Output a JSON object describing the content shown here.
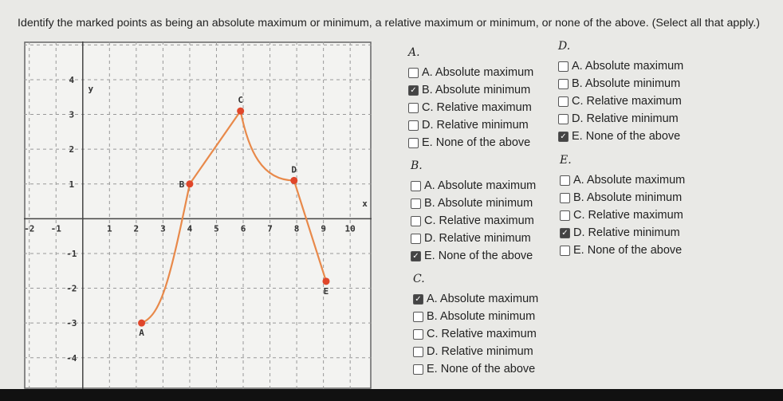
{
  "question": "Identify the marked points as being an absolute maximum or minimum, a relative maximum or minimum, or none of the above. (Select all that apply.)",
  "graph": {
    "x_label": "x",
    "y_label": "y",
    "x_ticks": [
      -2,
      -1,
      1,
      2,
      3,
      4,
      5,
      6,
      7,
      8,
      9,
      10
    ],
    "y_ticks": [
      -4,
      -3,
      -2,
      -1,
      1,
      2,
      3,
      4
    ],
    "xlim": [
      -2.2,
      10.8
    ],
    "ylim": [
      -4.9,
      5.1
    ],
    "grid": true,
    "curve_color": "#e8894a",
    "point_color": "#e0462a",
    "points": [
      {
        "label": "A",
        "x": 2.2,
        "y": -3
      },
      {
        "label": "B",
        "x": 4,
        "y": 1
      },
      {
        "label": "C",
        "x": 5.9,
        "y": 3.1
      },
      {
        "label": "D",
        "x": 7.9,
        "y": 1.1
      },
      {
        "label": "E",
        "x": 9.1,
        "y": -1.8
      }
    ]
  },
  "groups": [
    {
      "title": "A.",
      "options": [
        {
          "label": "A. Absolute maximum",
          "checked": false
        },
        {
          "label": "B. Absolute minimum",
          "checked": true
        },
        {
          "label": "C. Relative maximum",
          "checked": false
        },
        {
          "label": "D. Relative minimum",
          "checked": false
        },
        {
          "label": "E. None of the above",
          "checked": false
        }
      ]
    },
    {
      "title": "B.",
      "options": [
        {
          "label": "A. Absolute maximum",
          "checked": false
        },
        {
          "label": "B. Absolute minimum",
          "checked": false
        },
        {
          "label": "C. Relative maximum",
          "checked": false
        },
        {
          "label": "D. Relative minimum",
          "checked": false
        },
        {
          "label": "E. None of the above",
          "checked": true
        }
      ]
    },
    {
      "title": "C.",
      "options": [
        {
          "label": "A. Absolute maximum",
          "checked": true
        },
        {
          "label": "B. Absolute minimum",
          "checked": false
        },
        {
          "label": "C. Relative maximum",
          "checked": false
        },
        {
          "label": "D. Relative minimum",
          "checked": false
        },
        {
          "label": "E. None of the above",
          "checked": false
        }
      ]
    },
    {
      "title": "D.",
      "options": [
        {
          "label": "A. Absolute maximum",
          "checked": false
        },
        {
          "label": "B. Absolute minimum",
          "checked": false
        },
        {
          "label": "C. Relative maximum",
          "checked": false
        },
        {
          "label": "D. Relative minimum",
          "checked": false
        },
        {
          "label": "E. None of the above",
          "checked": true
        }
      ]
    },
    {
      "title": "E.",
      "options": [
        {
          "label": "A. Absolute maximum",
          "checked": false
        },
        {
          "label": "B. Absolute minimum",
          "checked": false
        },
        {
          "label": "C. Relative maximum",
          "checked": false
        },
        {
          "label": "D. Relative minimum",
          "checked": true
        },
        {
          "label": "E. None of the above",
          "checked": false
        }
      ]
    }
  ]
}
